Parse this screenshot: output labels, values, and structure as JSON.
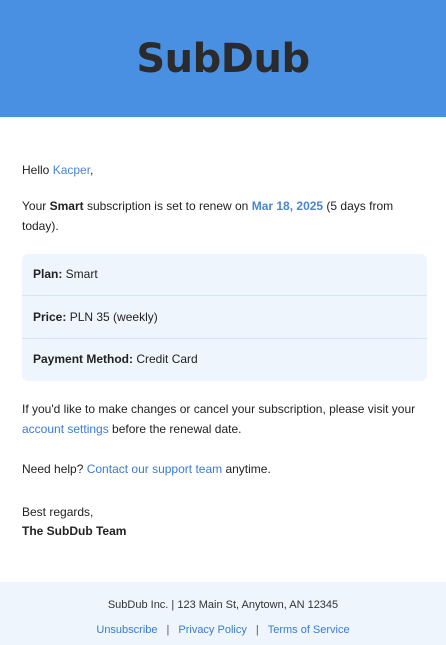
{
  "header": {
    "brand": "SubDub"
  },
  "email": {
    "greeting_prefix": "Hello ",
    "user_name": "Kacper",
    "greeting_suffix": ",",
    "renewal_prefix": "Your ",
    "plan_name": "Smart",
    "renewal_middle": " subscription is set to renew on ",
    "renewal_date": "Mar 18, 2025",
    "renewal_suffix": " (5 days from today).",
    "details": {
      "plan_label": "Plan:",
      "plan_value": " Smart",
      "price_label": "Price:",
      "price_value": " PLN 35 (weekly)",
      "payment_label": "Payment Method:",
      "payment_value": " Credit Card"
    },
    "changes_prefix": "If you'd like to make changes or cancel your subscription, please visit your ",
    "account_settings_link": "account settings",
    "changes_suffix": " before the renewal date.",
    "help_prefix": "Need help? ",
    "support_link": "Contact our support team",
    "help_suffix": " anytime.",
    "signoff": "Best regards,",
    "team": "The SubDub Team"
  },
  "footer": {
    "address": "SubDub Inc. | 123 Main St, Anytown, AN 12345",
    "links": {
      "unsubscribe": "Unsubscribe",
      "privacy": "Privacy Policy",
      "terms": "Terms of Service",
      "separator": "|"
    }
  },
  "colors": {
    "header_bg": "#4a90e2",
    "accent": "#4a86d0",
    "panel_bg": "#eef5fd"
  }
}
